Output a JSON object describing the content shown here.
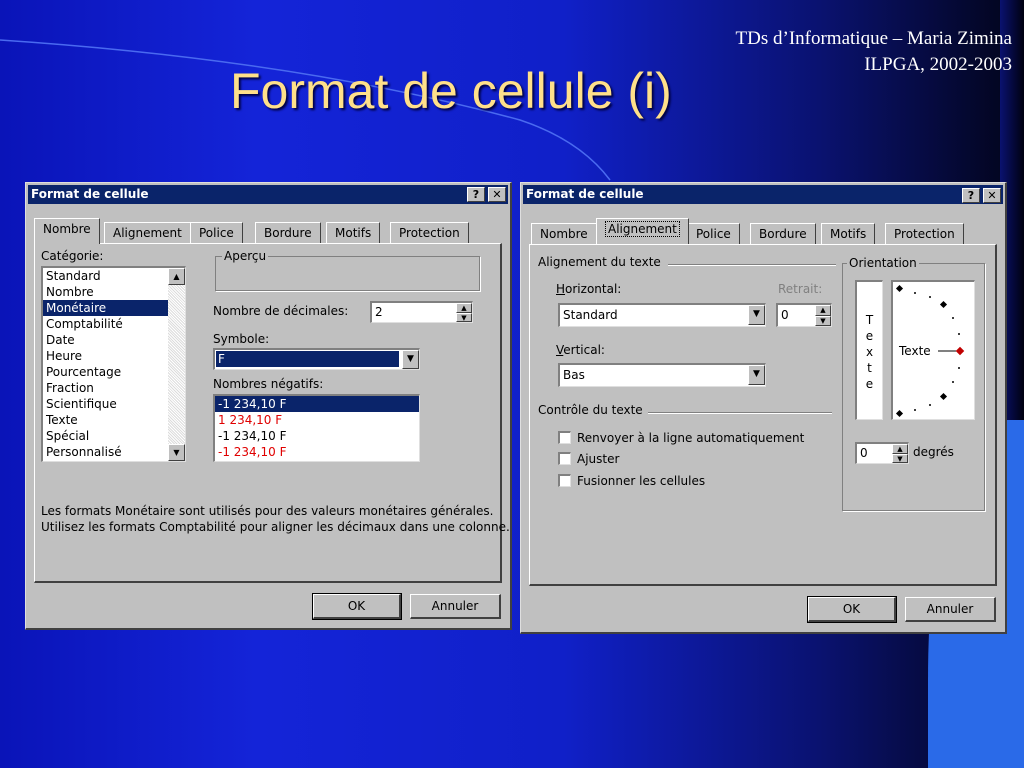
{
  "slide": {
    "title": "Format de cellule (i)",
    "credit_line1": "TDs d’Informatique – Maria Zimina",
    "credit_line2": "ILPGA, 2002-2003"
  },
  "dialog_left": {
    "title": "Format de cellule",
    "help_label": "?",
    "close_label": "✕",
    "tabs": [
      "Nombre",
      "Alignement",
      "Police",
      "Bordure",
      "Motifs",
      "Protection"
    ],
    "active_tab": "Nombre",
    "category_label": "Catégorie:",
    "categories": [
      "Standard",
      "Nombre",
      "Monétaire",
      "Comptabilité",
      "Date",
      "Heure",
      "Pourcentage",
      "Fraction",
      "Scientifique",
      "Texte",
      "Spécial",
      "Personnalisé"
    ],
    "selected_category": "Monétaire",
    "preview_label": "Aperçu",
    "decimals_label": "Nombre de décimales:",
    "decimals_value": "2",
    "symbol_label": "Symbole:",
    "symbol_value": "F",
    "negative_label": "Nombres négatifs:",
    "negative_options": [
      "-1 234,10 F",
      "1 234,10 F",
      "-1 234,10 F",
      "-1 234,10 F"
    ],
    "description_line1": "Les formats Monétaire sont utilisés pour des valeurs monétaires générales.",
    "description_line2": "Utilisez les formats Comptabilité pour aligner les décimaux dans une colonne.",
    "ok_label": "OK",
    "cancel_label": "Annuler"
  },
  "dialog_right": {
    "title": "Format de cellule",
    "help_label": "?",
    "close_label": "✕",
    "tabs": [
      "Nombre",
      "Alignement",
      "Police",
      "Bordure",
      "Motifs",
      "Protection"
    ],
    "active_tab": "Alignement",
    "text_alignment_group": "Alignement du texte",
    "horizontal_label": "Horizontal:",
    "horizontal_value": "Standard",
    "indent_label": "Retrait:",
    "indent_value": "0",
    "vertical_label": "Vertical:",
    "vertical_value": "Bas",
    "text_control_group": "Contrôle du texte",
    "wrap_text_label": "Renvoyer à la ligne automatiquement",
    "shrink_label": "Ajuster",
    "merge_label": "Fusionner les cellules",
    "orientation_group": "Orientation",
    "vertical_text_letters": [
      "T",
      "e",
      "x",
      "t",
      "e"
    ],
    "orientation_text": "Texte",
    "degrees_value": "0",
    "degrees_label": "degrés",
    "ok_label": "OK",
    "cancel_label": "Annuler"
  },
  "colors": {
    "background_blue": "#1020c8",
    "title_gold": "#ffe08a",
    "dialog_face": "#c0c0c0",
    "titlebar_navy": "#0a246a",
    "negative_red": "#e00000"
  }
}
